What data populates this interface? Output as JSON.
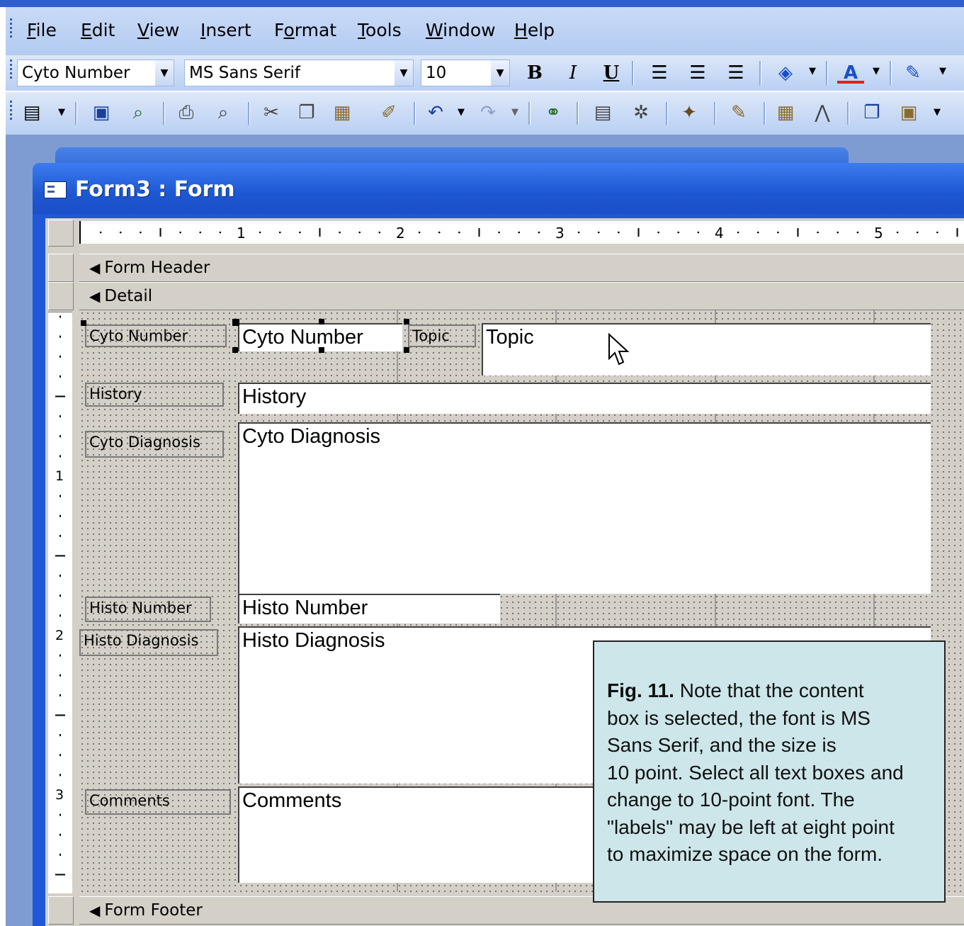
{
  "menu": {
    "items": [
      {
        "pre": "",
        "key": "F",
        "post": "ile"
      },
      {
        "pre": "",
        "key": "E",
        "post": "dit"
      },
      {
        "pre": "",
        "key": "V",
        "post": "iew"
      },
      {
        "pre": "",
        "key": "I",
        "post": "nsert"
      },
      {
        "pre": "F",
        "key": "o",
        "post": "rmat"
      },
      {
        "pre": "",
        "key": "T",
        "post": "ools"
      },
      {
        "pre": "",
        "key": "W",
        "post": "indow"
      },
      {
        "pre": "",
        "key": "H",
        "post": "elp"
      }
    ]
  },
  "format_toolbar": {
    "object_combo": "Cyto Number",
    "font_combo": "MS Sans Serif",
    "size_combo": "10",
    "bold": "B",
    "italic": "I",
    "underline": "U"
  },
  "form_window": {
    "title": "Form3 : Form"
  },
  "ruler": {
    "h_marks": [
      "1",
      "2",
      "3",
      "4",
      "5"
    ],
    "v_marks": [
      "1",
      "2",
      "3"
    ]
  },
  "sections": {
    "header": "Form Header",
    "detail": "Detail",
    "footer": "Form Footer"
  },
  "controls": {
    "cyto_number_label": "Cyto Number",
    "cyto_number_box": "Cyto Number",
    "topic_label": "Topic",
    "topic_box": "Topic",
    "history_label": "History",
    "history_box": "History",
    "cyto_diagnosis_label": "Cyto Diagnosis",
    "cyto_diagnosis_box": "Cyto Diagnosis",
    "histo_number_label": "Histo Number",
    "histo_number_box": "Histo Number",
    "histo_diagnosis_label": "Histo Diagnosis",
    "histo_diagnosis_box": "Histo Diagnosis",
    "comments_label": "Comments",
    "comments_box": "Comments"
  },
  "callout": {
    "fig": "Fig. 11.",
    "line1": " Note that the content",
    "line2": "box is selected, the font is MS",
    "line3": "Sans Serif, and the size is",
    "line4": "10 point. Select all text boxes and",
    "line5": "change to 10-point font. The",
    "line6": "\"labels\" may be left at eight point",
    "line7": "to maximize space on the form."
  },
  "colors": {
    "menu_bg": "#c9daf6",
    "title_bar": "#1d57d2",
    "form_body": "#d4d0c8",
    "callout_bg": "#cde6ea"
  }
}
